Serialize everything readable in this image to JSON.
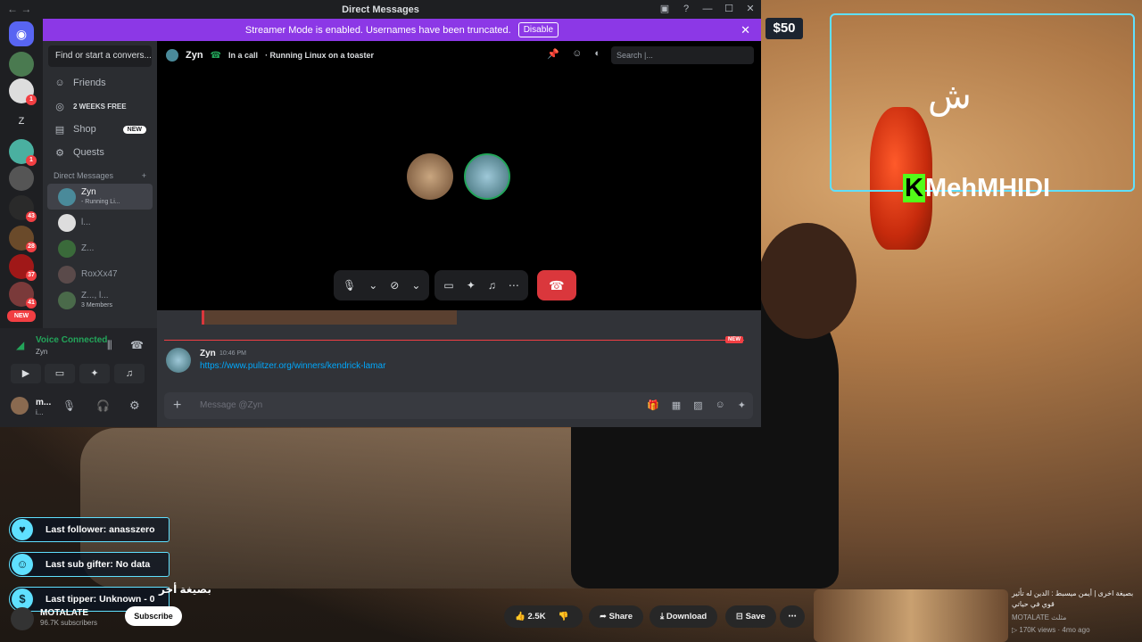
{
  "window": {
    "title": "Direct Messages",
    "nav": "←  →"
  },
  "banner": {
    "text": "Streamer Mode is enabled. Usernames have been truncated.",
    "button": "Disable"
  },
  "servers": {
    "home_badge": "",
    "badges": [
      "1",
      "Z",
      "1",
      "43",
      "28",
      "37",
      "41"
    ],
    "new_label": "NEW"
  },
  "dm": {
    "search_placeholder": "Find or start a convers...",
    "nav": [
      {
        "label": "Friends",
        "icon": "friends-icon"
      },
      {
        "label": "2 WEEKS FREE",
        "icon": "nitro-icon"
      },
      {
        "label": "Shop",
        "icon": "shop-icon",
        "badge": "NEW"
      },
      {
        "label": "Quests",
        "icon": "quests-icon"
      }
    ],
    "section_title": "Direct Messages",
    "add_icon": "+",
    "conversations": [
      {
        "name": "Zyn",
        "sub": "- Running Li..."
      },
      {
        "name": "l...",
        "sub": ""
      },
      {
        "name": "Z...",
        "sub": ""
      },
      {
        "name": "RoxXx47",
        "sub": ""
      },
      {
        "name": "Z..., l...",
        "sub": "3 Members"
      }
    ]
  },
  "voice": {
    "status": "Voice Connected",
    "channel": "Zyn",
    "user": "m...",
    "user_sub": "i..."
  },
  "call": {
    "user": "Zyn",
    "status": "In a call",
    "activity": "· Running Linux on a toaster",
    "search_placeholder": "Search |..."
  },
  "chat": {
    "new_label": "NEW",
    "message": {
      "author": "Zyn",
      "time": "10:46 PM",
      "link": "https://www.pulitzer.org/winners/kendrick-lamar"
    },
    "composer_placeholder": "Message @Zyn"
  },
  "overlay": {
    "tip_amount": "$50",
    "logo": "ش",
    "streamer_name_k": "K",
    "streamer_name": "MehMHIDI",
    "events": [
      {
        "label": "Last follower: anasszero",
        "icon": "heart-icon"
      },
      {
        "label": "Last sub gifter: No data",
        "icon": "gift-icon"
      },
      {
        "label": "Last tipper: Unknown - 0",
        "icon": "dollar-icon"
      }
    ]
  },
  "youtube": {
    "title": "بصيغة أخر",
    "channel": "MOTALATE",
    "subscribers": "96.7K subscribers",
    "subscribe": "Subscribe",
    "likes": "2.5K",
    "share": "Share",
    "download": "Download",
    "save": "Save",
    "related": {
      "title": "بصيغة اخرى | أيمن ميسبط : الدين له تأثير قوي في حياتي",
      "channel": "MOTALATE مثلث",
      "meta": "▷ 170K views · 4mo ago"
    }
  },
  "colors": {
    "accent": "#5865f2",
    "streamer_banner": "#8c38e6",
    "danger": "#da373c",
    "link": "#00a8fc",
    "overlay": "#5fe0ff",
    "kick": "#53fc18"
  }
}
